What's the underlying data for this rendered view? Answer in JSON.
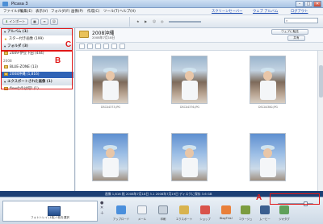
{
  "window": {
    "title": "Picasa 3"
  },
  "menu": [
    "ファイル(F)",
    "編集(E)",
    "表示(V)",
    "フォルダ(F)",
    "画像(P)",
    "作成(C)",
    "ツール(T)",
    "ヘルプ(H)"
  ],
  "top_links": {
    "screensaver": "スクリーンセーバー",
    "web_albums": "ウェブ アルバム",
    "logout": "ログアウト"
  },
  "toolbar": {
    "import_label": "インポート"
  },
  "left_panel": {
    "albums_header": "アルバム (1)",
    "album_starred": "スター付き画像 (199)",
    "folders_header": "フォルダ (3)",
    "folder_2009": "2009-伊豆下田 (444)",
    "year_2008": "2008",
    "folder_bluezone": "BLUE-ZONE (13)",
    "folder_okinawa": "2008沖縄 (1,816)",
    "exported_header": "エクスポートされた画像 (1)",
    "folder_exported": "flowなのは何? (1)"
  },
  "main": {
    "album_title": "2008沖縄",
    "album_date": "2008年7月18日",
    "upload_button": "ウェブに転送",
    "share_button": "共有",
    "captions": [
      "DSC04373.JPG",
      "DSC04376.JPG",
      "DSC04380.JPG",
      "",
      "",
      ""
    ]
  },
  "status": {
    "text": "画像 1,816 枚   2008年7月18日   3.1 2008年7月19日  ディスクに保存 3.6 GB"
  },
  "tray": {
    "label": "フォトトレイ (1枚) 1枚を選択"
  },
  "bottom_buttons": [
    "アップロード",
    "メール",
    "印刷",
    "エクスポート",
    "ショップ",
    "BlogThis!",
    "コラージュ",
    "ムービー",
    "ジオタグ"
  ],
  "annotations": {
    "a": "A",
    "b": "B",
    "c": "C"
  },
  "colors": {
    "status_bar": "#1c3f74",
    "selection": "#2f63b6",
    "annotation": "#e01818"
  }
}
